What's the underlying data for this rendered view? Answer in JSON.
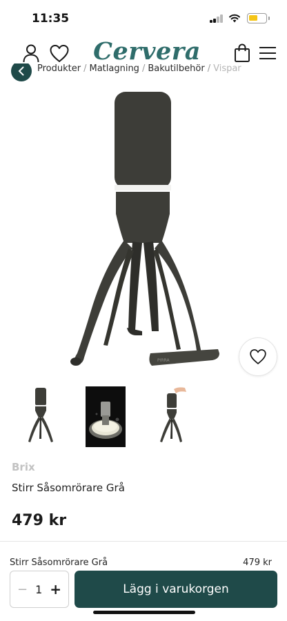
{
  "status_bar": {
    "time": "11:35"
  },
  "header": {
    "logo": "Cervera",
    "icons": [
      "user-icon",
      "heart-icon",
      "shopping-bag-icon",
      "menu-icon"
    ]
  },
  "breadcrumb": {
    "items": [
      "Produkter",
      "Matlagning",
      "Bakutilbehör",
      "Vispar"
    ]
  },
  "product": {
    "brand": "Brix",
    "title": "Stirr Såsomrörare Grå",
    "price": "479 kr",
    "image_label": "PIRRA",
    "thumbnails": 3
  },
  "sticky_bar": {
    "name": "Stirr Såsomrörare Grå",
    "price": "479 kr",
    "quantity": "1",
    "minus": "−",
    "plus": "+",
    "add_to_cart": "Lägg i varukorgen"
  },
  "colors": {
    "brand_teal": "#2f6d6b",
    "button_dark": "#1f4a49",
    "product_gray": "#3d3d38"
  }
}
